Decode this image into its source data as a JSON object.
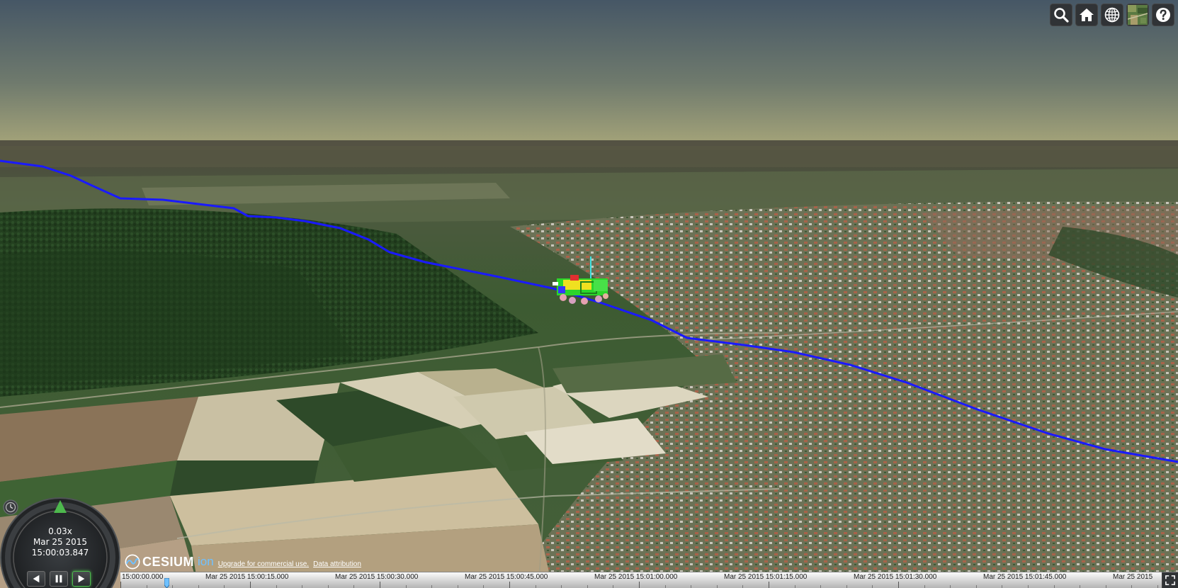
{
  "toolbar": {
    "buttons": [
      {
        "name": "geocoder-search-button",
        "icon": "search-icon"
      },
      {
        "name": "home-button",
        "icon": "home-icon"
      },
      {
        "name": "scene-mode-button",
        "icon": "globe-icon"
      },
      {
        "name": "base-layer-picker-button",
        "icon": "satellite-imagery-icon"
      },
      {
        "name": "help-button",
        "icon": "question-mark-icon"
      }
    ]
  },
  "animation": {
    "speed": "0.03x",
    "date": "Mar 25 2015",
    "time": "15:00:03.847",
    "buttons": [
      {
        "name": "play-reverse-button",
        "icon": "rewind-icon",
        "active": false
      },
      {
        "name": "pause-button",
        "icon": "pause-icon",
        "active": false
      },
      {
        "name": "play-button",
        "icon": "play-icon",
        "active": true
      }
    ]
  },
  "credits": {
    "logo_word": "CESIUM",
    "logo_suffix": "ion",
    "upgrade_link": "Upgrade for commercial use.",
    "attribution_link": "Data attribution"
  },
  "timeline": {
    "labels": [
      "15:00:00.000",
      "Mar 25 2015 15:00:15.000",
      "Mar 25 2015 15:00:30.000",
      "Mar 25 2015 15:00:45.000",
      "Mar 25 2015 15:01:00.000",
      "Mar 25 2015 15:01:15.000",
      "Mar 25 2015 15:01:30.000",
      "Mar 25 2015 15:01:45.000",
      "Mar 25 2015"
    ],
    "current_time_fraction": 0.028
  },
  "colors": {
    "flight_path": "#1a1aff",
    "sky_top": "#4a5a66",
    "sky_horizon": "#a8a77c",
    "widget_bg": "#303336",
    "play_active": "#4db84d",
    "ion_blue": "#6fc1ff"
  }
}
